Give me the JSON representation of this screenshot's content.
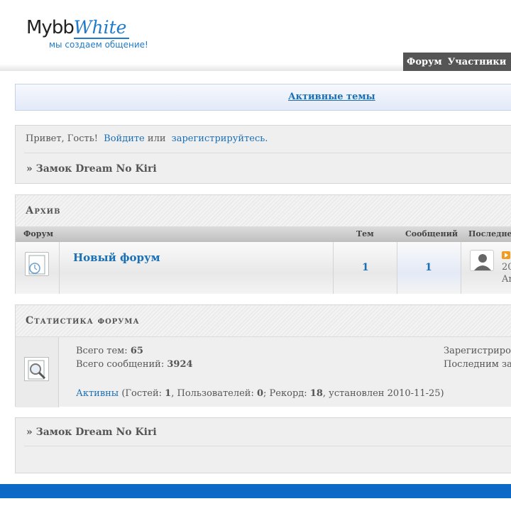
{
  "header": {
    "logo_main": "Mybb",
    "logo_accent": "White",
    "tagline": "мы создаем общение!",
    "nav": [
      "Форум",
      "Участники"
    ]
  },
  "active_topics": "Активные темы",
  "welcome": {
    "greeting": "Привет, Гость!",
    "login": "Войдите",
    "or": "или",
    "register": "зарегистрируйтесь.",
    "breadcrumb": "» Замок Dream No Kiri"
  },
  "archive": {
    "title": "Архив",
    "columns": {
      "forum": "Форум",
      "topics": "Тем",
      "posts": "Сообщений",
      "last": "Последне"
    },
    "forum": {
      "name": "Новый форум",
      "topics": "1",
      "posts": "1",
      "last_date": "20",
      "last_user": "An"
    }
  },
  "stats": {
    "title": "Статистика форума",
    "total_topics_label": "Всего тем:",
    "total_topics": "65",
    "total_posts_label": "Всего сообщений:",
    "total_posts": "3924",
    "registered_label": "Зарегистриро",
    "last_label": "Последним за",
    "active_link": "Активны",
    "guests_label": "(Гостей:",
    "guests": "1",
    "users_label": ", Пользователей:",
    "users": "0",
    "record_label": "; Рекорд:",
    "record": "18",
    "record_date": ", установлен 2010-11-25)"
  },
  "bottom": {
    "breadcrumb": "» Замок Dream No Kiri"
  },
  "colors": {
    "link": "#1a6fb5",
    "footer": "#0c6ac6",
    "nav_bg": "#555555"
  }
}
